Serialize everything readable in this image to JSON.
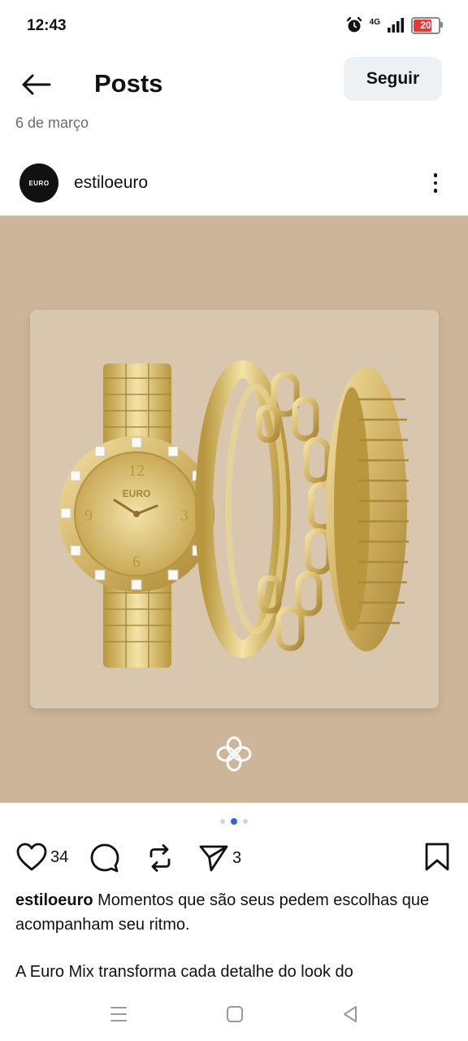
{
  "status_bar": {
    "time": "12:43",
    "network": "4G",
    "battery": "20",
    "battery_color": "#e23b3b",
    "icons": [
      "alarm-icon",
      "network-4g-icon",
      "signal-icon",
      "battery-icon"
    ]
  },
  "header": {
    "title": "Posts",
    "follow_label": "Seguir",
    "back_icon": "arrow-left-icon"
  },
  "prev_post_date": "6 de março",
  "post": {
    "avatar_text": "EURO",
    "username": "estiloeuro",
    "more_icon": "more-vertical-icon",
    "carousel": {
      "count": 3,
      "active": 2
    },
    "image": {
      "background_color": "#cdb59a",
      "watch_dial": {
        "brand": "EURO",
        "numerals": [
          "12",
          "9",
          "3",
          "6"
        ]
      },
      "brand_mark_icon": "euro-flower-logo-icon"
    },
    "likes": "34",
    "shares": "3",
    "caption": {
      "username": "estiloeuro",
      "text": "Momentos que são seus pedem escolhas que acompanham seu ritmo.",
      "text_2": "A Euro Mix transforma cada detalhe do look do"
    }
  },
  "nav_bar": {
    "icons": [
      "menu-icon",
      "home-square-icon",
      "back-triangle-icon"
    ]
  }
}
